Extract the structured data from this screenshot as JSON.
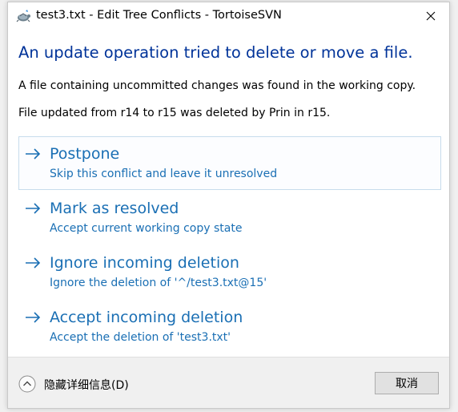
{
  "window": {
    "title": "test3.txt - Edit Tree Conflicts - TortoiseSVN"
  },
  "dialog": {
    "main_instruction": "An update operation tried to delete or move a file.",
    "content_line1": "A file containing uncommitted changes was found in the working copy.",
    "content_line2": "File updated from r14 to r15 was deleted by Prin in r15."
  },
  "commands": [
    {
      "title": "Postpone",
      "description": "Skip this conflict and leave it unresolved"
    },
    {
      "title": "Mark as resolved",
      "description": "Accept current working copy state"
    },
    {
      "title": "Ignore incoming deletion",
      "description": "Ignore the deletion of '^/test3.txt@15'"
    },
    {
      "title": "Accept incoming deletion",
      "description": "Accept the deletion of 'test3.txt'"
    }
  ],
  "footer": {
    "expander_label": "隐藏详细信息(D)",
    "cancel_label": "取消"
  },
  "colors": {
    "instruction": "#003399",
    "link": "#1a6fb4",
    "focus_border": "#c7dcec"
  }
}
